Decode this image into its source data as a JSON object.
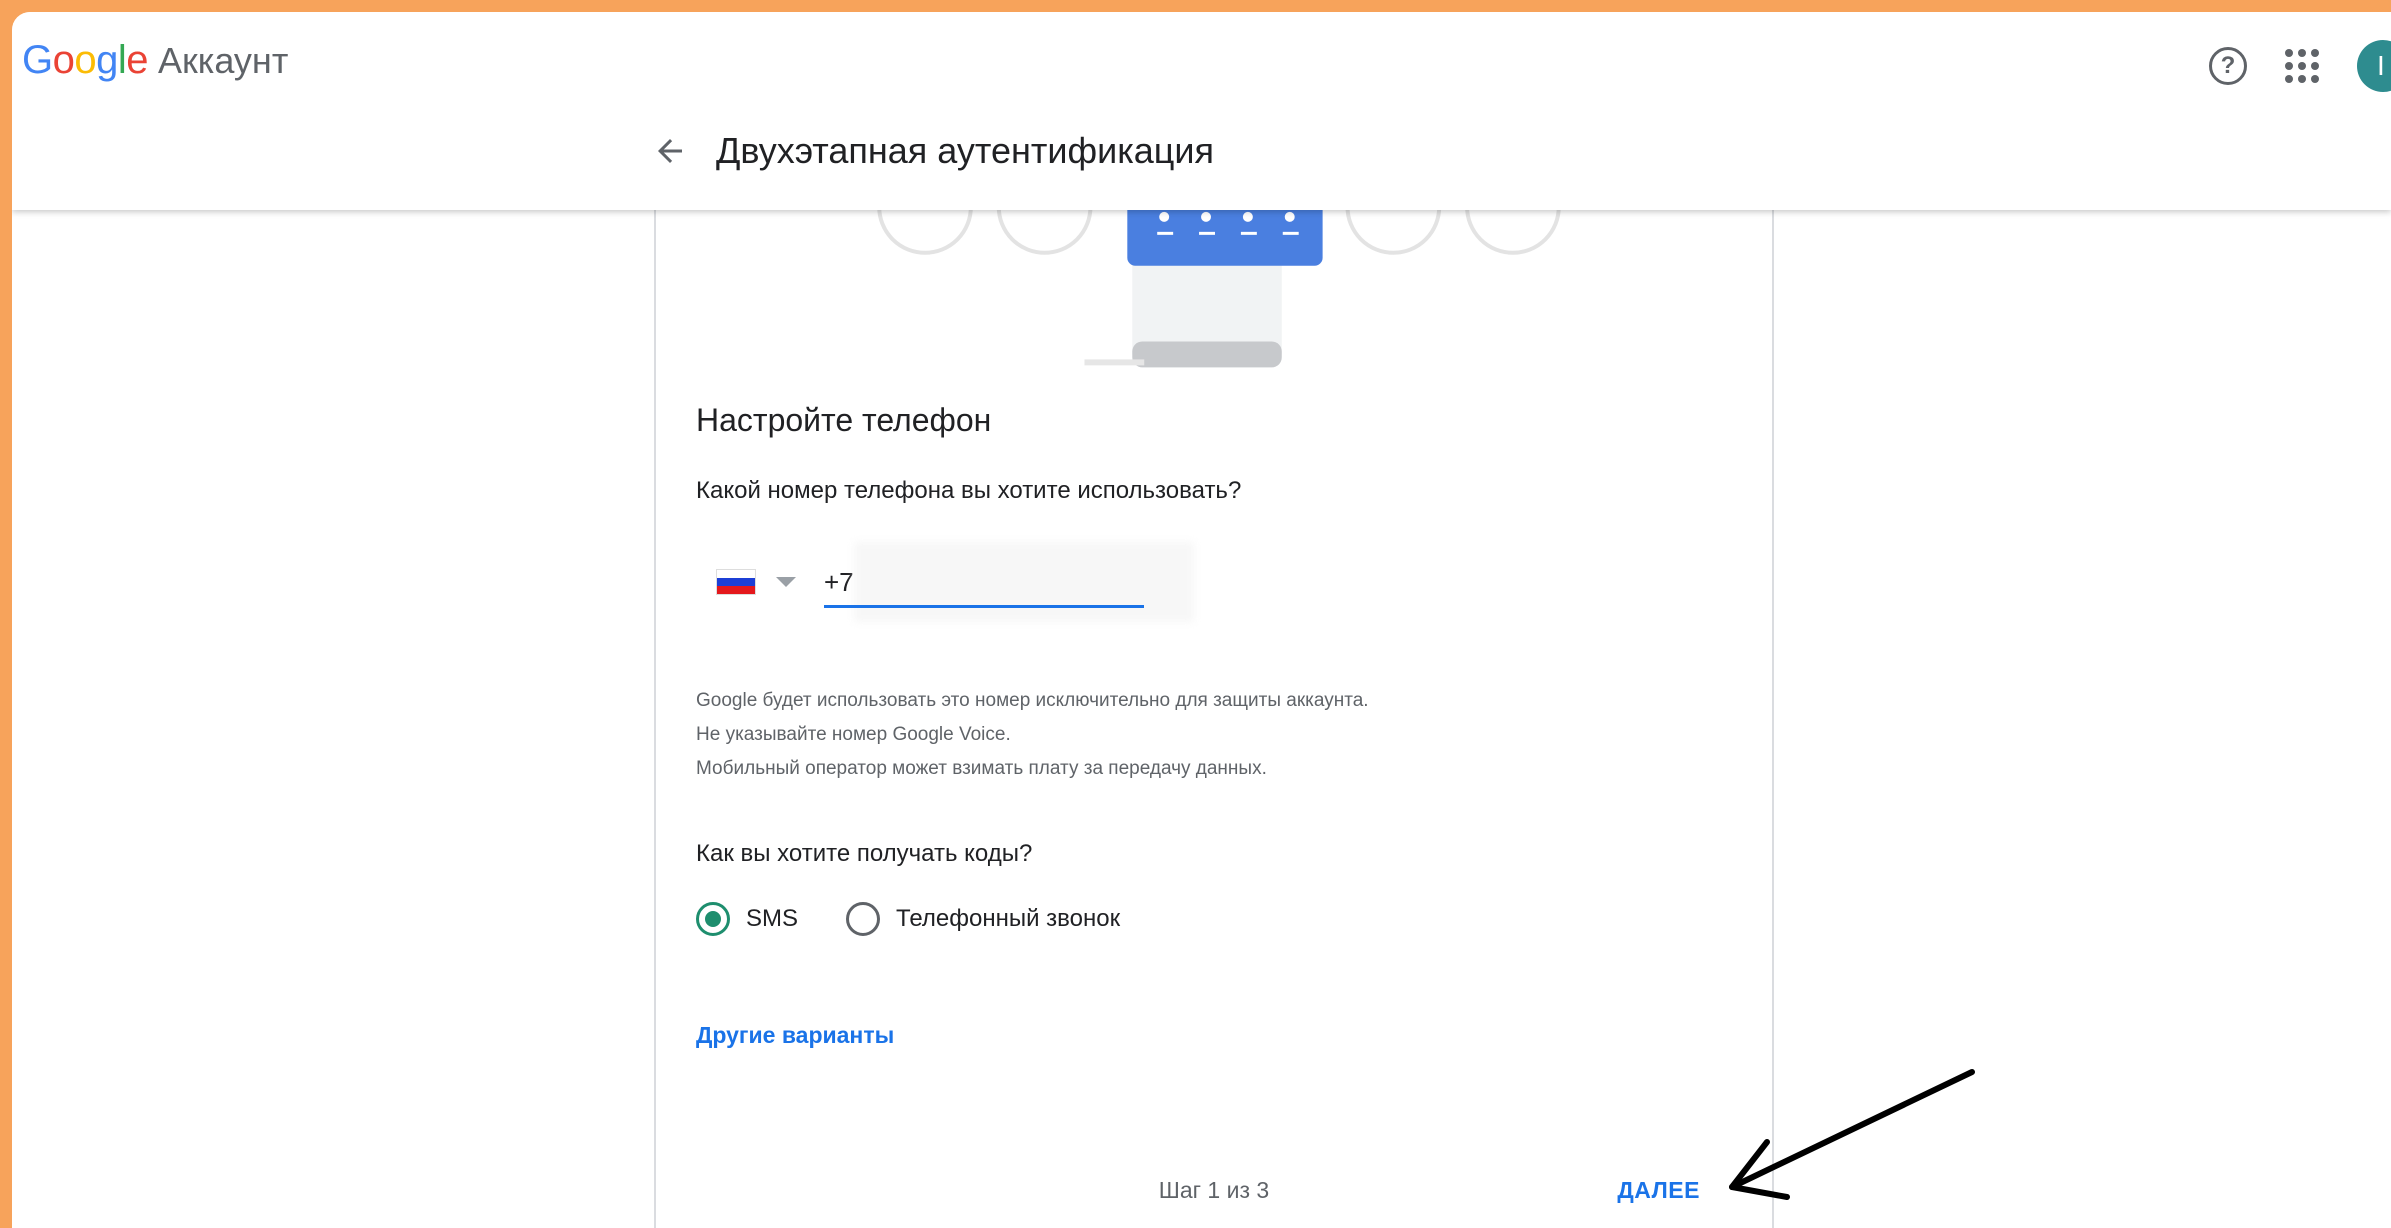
{
  "header": {
    "logo_word": "Google",
    "product": "Аккаунт",
    "avatar_initial": "I",
    "page_title": "Двухэтапная аутентификация"
  },
  "icons": {
    "help": "help-icon",
    "apps": "apps-grid-icon",
    "back": "arrow-left-icon"
  },
  "colors": {
    "accent": "#1a73e8",
    "radio_checked": "#1e8e6e",
    "avatar": "#2E8C8F",
    "frame": "#F7A35B"
  },
  "form": {
    "section_title": "Настройте телефон",
    "phone_question": "Какой номер телефона вы хотите использовать?",
    "country_code": "+7",
    "hint_lines": [
      "Google будет использовать это номер исключительно для защиты аккаунта.",
      "Не указывайте номер Google Voice.",
      "Мобильный оператор может взимать плату за передачу данных."
    ],
    "codes_question": "Как вы хотите получать коды?",
    "options": [
      {
        "label": "SMS",
        "checked": true
      },
      {
        "label": "Телефонный звонок",
        "checked": false
      }
    ],
    "other_options": "Другие варианты",
    "step": "Шаг 1 из 3",
    "next": "ДАЛЕЕ"
  }
}
